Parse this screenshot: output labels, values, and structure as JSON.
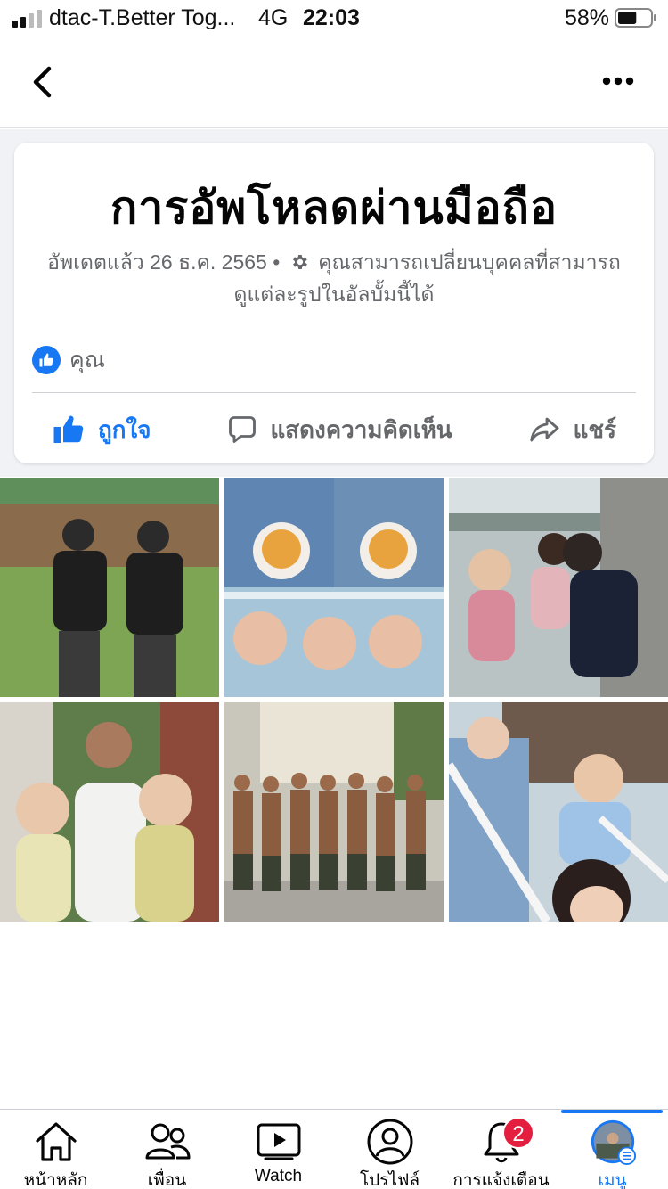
{
  "status_bar": {
    "carrier": "dtac-T.Better Tog...",
    "network": "4G",
    "time": "22:03",
    "battery": "58%",
    "battery_level": 0.58
  },
  "nav": {
    "back_icon": "chevron-left-icon",
    "more_icon": "more-horizontal-icon"
  },
  "album": {
    "title": "การอัพโหลดผ่านมือถือ",
    "updated": "อัพเดตแล้ว 26 ธ.ค. 2565",
    "separator": "•",
    "privacy_note": "คุณสามารถเปลี่ยนบุคคลที่สามารถดูแต่ละรูปในอัลบั้มนี้ได้",
    "reactor": "คุณ",
    "actions": {
      "like": "ถูกใจ",
      "comment": "แสดงความคิดเห็น",
      "share": "แชร์"
    },
    "accent_color": "#1877f2"
  },
  "photos": [
    {
      "subject": "two officers in black uniforms"
    },
    {
      "subject": "collage of baby and food bowl"
    },
    {
      "subject": "family with baby by the river"
    },
    {
      "subject": "man holding twin babies"
    },
    {
      "subject": "group of shirtless trainees"
    },
    {
      "subject": "selfie with babies on balcony"
    }
  ],
  "tabbar": {
    "tabs": [
      {
        "label": "หน้าหลัก",
        "icon": "home-icon"
      },
      {
        "label": "เพื่อน",
        "icon": "friends-icon"
      },
      {
        "label": "Watch",
        "icon": "watch-icon"
      },
      {
        "label": "โปรไฟล์",
        "icon": "profile-icon"
      },
      {
        "label": "การแจ้งเตือน",
        "icon": "bell-icon",
        "badge": "2"
      },
      {
        "label": "เมนู",
        "icon": "menu-avatar-icon"
      }
    ]
  }
}
